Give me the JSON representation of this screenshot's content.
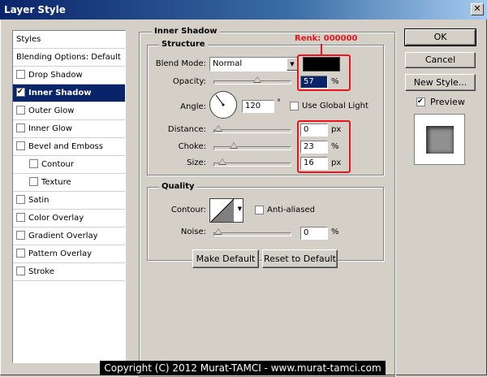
{
  "window": {
    "title": "Layer Style",
    "close_glyph": "✕"
  },
  "styles_list": {
    "header": "Styles",
    "items": [
      {
        "label": "Blending Options: Default",
        "checkbox": false,
        "checked": false
      },
      {
        "label": "Drop Shadow",
        "checkbox": true,
        "checked": false
      },
      {
        "label": "Inner Shadow",
        "checkbox": true,
        "checked": true,
        "selected": true
      },
      {
        "label": "Outer Glow",
        "checkbox": true,
        "checked": false
      },
      {
        "label": "Inner Glow",
        "checkbox": true,
        "checked": false
      },
      {
        "label": "Bevel and Emboss",
        "checkbox": true,
        "checked": false
      },
      {
        "label": "Contour",
        "checkbox": true,
        "checked": false,
        "indent": true
      },
      {
        "label": "Texture",
        "checkbox": true,
        "checked": false,
        "indent": true
      },
      {
        "label": "Satin",
        "checkbox": true,
        "checked": false
      },
      {
        "label": "Color Overlay",
        "checkbox": true,
        "checked": false
      },
      {
        "label": "Gradient Overlay",
        "checkbox": true,
        "checked": false
      },
      {
        "label": "Pattern Overlay",
        "checkbox": true,
        "checked": false
      },
      {
        "label": "Stroke",
        "checkbox": true,
        "checked": false
      }
    ]
  },
  "inner_shadow": {
    "title": "Inner Shadow",
    "structure": {
      "title": "Structure",
      "blend_mode_label": "Blend Mode:",
      "blend_mode_value": "Normal",
      "color_swatch": "#000000",
      "opacity_label": "Opacity:",
      "opacity_value": "57",
      "opacity_slider": 0.57,
      "percent_unit": "%",
      "angle_label": "Angle:",
      "angle_value": "120",
      "degree_unit": "°",
      "use_global_light_label": "Use Global Light",
      "distance_label": "Distance:",
      "distance_value": "0",
      "distance_slider": 0,
      "px_unit": "px",
      "choke_label": "Choke:",
      "choke_value": "23",
      "choke_slider": 0.23,
      "size_label": "Size:",
      "size_value": "16",
      "size_slider": 0.064
    },
    "quality": {
      "title": "Quality",
      "contour_label": "Contour:",
      "anti_aliased_label": "Anti-aliased",
      "noise_label": "Noise:",
      "noise_value": "0",
      "noise_slider": 0
    },
    "make_default": "Make Default",
    "reset_default": "Reset to Default"
  },
  "annotation": {
    "label": "Renk: 000000",
    "color": "#e8141e"
  },
  "buttons": {
    "ok": "OK",
    "cancel": "Cancel",
    "new_style": "New Style...",
    "preview_label": "Preview"
  },
  "copyright": "Copyright (C) 2012 Murat-TAMCI - www.murat-tamci.com"
}
